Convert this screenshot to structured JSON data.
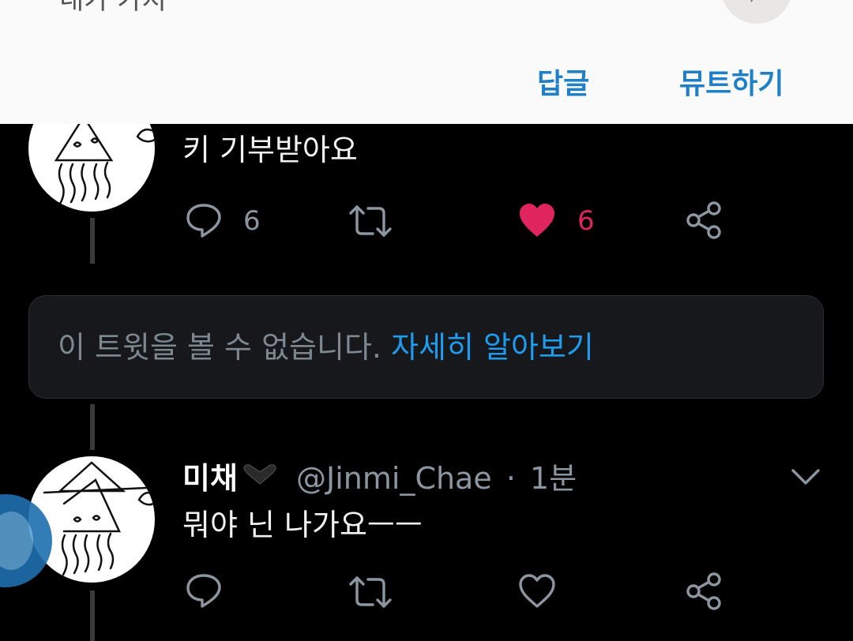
{
  "notification": {
    "text": "내가 가지",
    "reply_label": "답글",
    "mute_label": "뮤트하기"
  },
  "tweets": [
    {
      "text": "키 기부받아요",
      "reply_count": "6",
      "like_count": "6",
      "liked": true
    },
    {
      "name": "미채",
      "handle": "@Jinmi_Chae",
      "separator": "·",
      "time": "1분",
      "text": "뭐야 닌 나가요ㅡㅡ",
      "liked": false
    }
  ],
  "unavailable_notice": {
    "message": "이 트윗을 볼 수 없습니다.",
    "link": "자세히 알아보기"
  },
  "colors": {
    "accent": "#1f9bf0",
    "like": "#e0245e",
    "muted": "#8b96a0",
    "notification_button": "#1f80c7"
  },
  "icons": [
    "reply-icon",
    "retweet-icon",
    "heart-icon",
    "share-icon",
    "chevron-down-icon"
  ]
}
